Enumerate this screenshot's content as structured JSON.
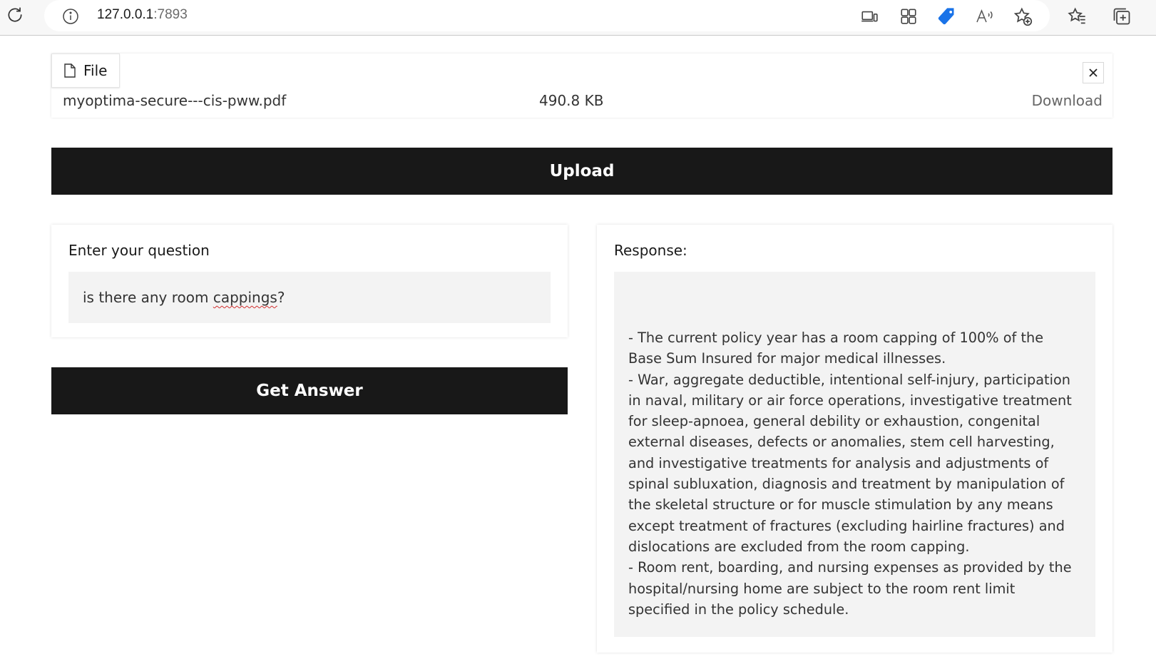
{
  "browser": {
    "url_host": "127.0.0.1",
    "url_port": ":7893",
    "icons": [
      "reload-icon",
      "info-icon",
      "device-icon",
      "apps-icon",
      "tag-icon",
      "read-aloud-icon",
      "add-favorite-icon",
      "favorites-icon",
      "collections-icon"
    ]
  },
  "file": {
    "tab_label": "File",
    "name": "myoptima-secure---cis-pww.pdf",
    "size": "490.8 KB",
    "download_label": "Download"
  },
  "upload_label": "Upload",
  "question": {
    "label": "Enter your question",
    "value_before": "is there any room ",
    "value_misspelled": "cappings",
    "value_after": "?"
  },
  "get_answer_label": "Get Answer",
  "response": {
    "label": "Response:",
    "lines": [
      "- The current policy year has a room capping of 100% of the",
      "Base Sum Insured for major medical illnesses.",
      "- War, aggregate deductible, intentional self-injury, participation",
      "in naval, military or air force operations, investigative treatment",
      "for sleep-apnoea, general debility or exhaustion, congenital",
      "external diseases, defects or anomalies, stem cell harvesting,",
      "and investigative treatments for analysis and adjustments of",
      "spinal subluxation, diagnosis and treatment by manipulation of",
      "the skeletal structure or for muscle stimulation by any means",
      "except treatment of fractures (excluding hairline fractures) and",
      "dislocations are excluded from the room capping.",
      "- Room rent, boarding, and nursing expenses as provided by the",
      "hospital/nursing home are subject to the room rent limit",
      "specified in the policy schedule."
    ]
  },
  "colors": {
    "button_bg": "#181818",
    "input_bg": "#f3f3f3",
    "tag_icon": "#1a73e8"
  }
}
